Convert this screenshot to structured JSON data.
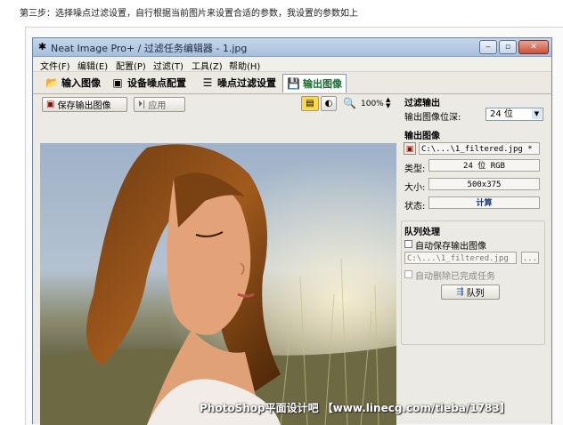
{
  "intro_text": "第三步：选择噪点过滤设置，自行根据当前图片来设置合适的参数，我设置的参数如上",
  "window": {
    "title": "Neat Image Pro+ / 过滤任务编辑器 - 1.jpg",
    "controls": {
      "minimize": "‒",
      "maximize": "▫",
      "close": "✕"
    }
  },
  "menu": [
    "文件(F)",
    "编辑(E)",
    "配置(P)",
    "过滤(T)",
    "工具(Z)",
    "帮助(H)"
  ],
  "tabs": [
    {
      "label": "输入图像",
      "icon": "folder-icon"
    },
    {
      "label": "设备噪点配置",
      "icon": "camera-icon"
    },
    {
      "label": "噪点过滤设置",
      "icon": "sliders-icon"
    },
    {
      "label": "输出图像",
      "icon": "save-icon",
      "active": true
    }
  ],
  "toolbar": {
    "save_label": "保存输出图像",
    "apply_label": "应用",
    "zoom": "100%"
  },
  "panel": {
    "filter_output_title": "过滤输出",
    "bit_depth_label": "输出图像位深:",
    "bit_depth_value": "24 位",
    "output_image_title": "输出图像",
    "output_path": "C:\\...\\1_filtered.jpg *",
    "type_label": "类型:",
    "type_value": "24 位 RGB",
    "size_label": "大小:",
    "size_value": "500x375",
    "status_label": "状态:",
    "status_value": "计算",
    "queue_title": "队列处理",
    "autosave_label": "自动保存输出图像",
    "queue_path": "C:\\...\\1_filtered.jpg",
    "browse_label": "...",
    "autodelete_label": "自动删除已完成任务",
    "queue_button": "队列"
  },
  "watermark": "PhotoShop平面设计吧 【www.linecg.com/tieba/1783】",
  "colors": {
    "accent": "#1a6b2d",
    "status": "#1a3a7a"
  }
}
